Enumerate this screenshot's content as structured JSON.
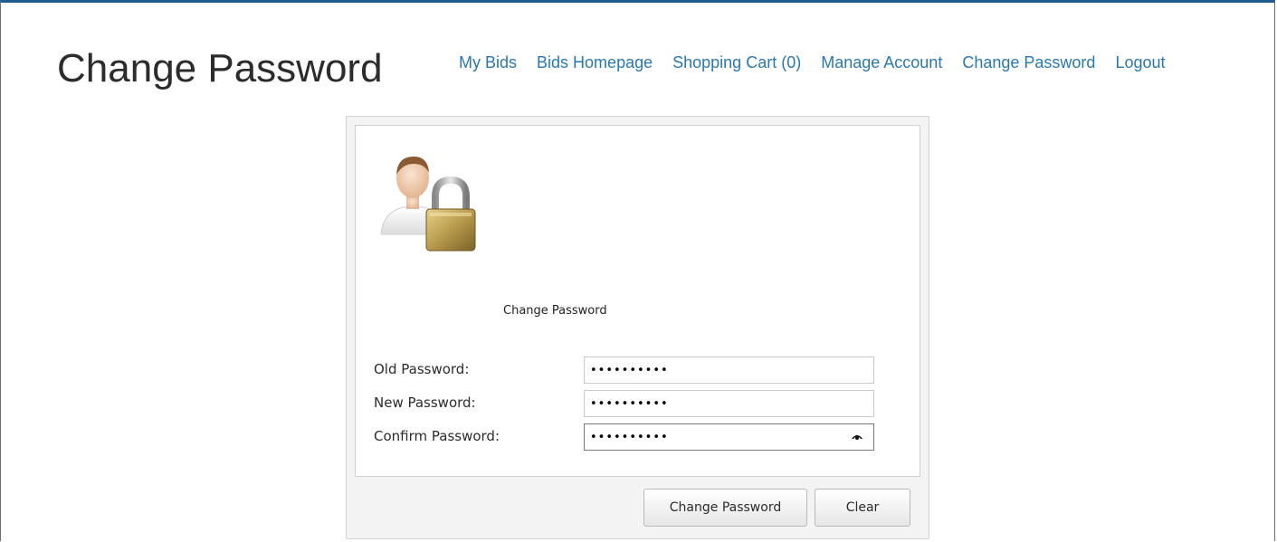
{
  "header": {
    "title": "Change Password",
    "nav": [
      {
        "label": "My Bids"
      },
      {
        "label": "Bids Homepage"
      },
      {
        "label": "Shopping Cart (0)"
      },
      {
        "label": "Manage Account"
      },
      {
        "label": "Change Password"
      },
      {
        "label": "Logout"
      }
    ]
  },
  "form": {
    "subtitle": "Change Password",
    "icon": "user-lock-icon",
    "fields": [
      {
        "label": "Old Password:",
        "value": "••••••••••"
      },
      {
        "label": "New Password:",
        "value": "••••••••••"
      },
      {
        "label": "Confirm Password:",
        "value": "••••••••••"
      }
    ],
    "buttons": {
      "submit_label": "Change Password",
      "clear_label": "Clear"
    }
  },
  "colors": {
    "link": "#2a78b0",
    "top_border": "#1f5c8f"
  }
}
